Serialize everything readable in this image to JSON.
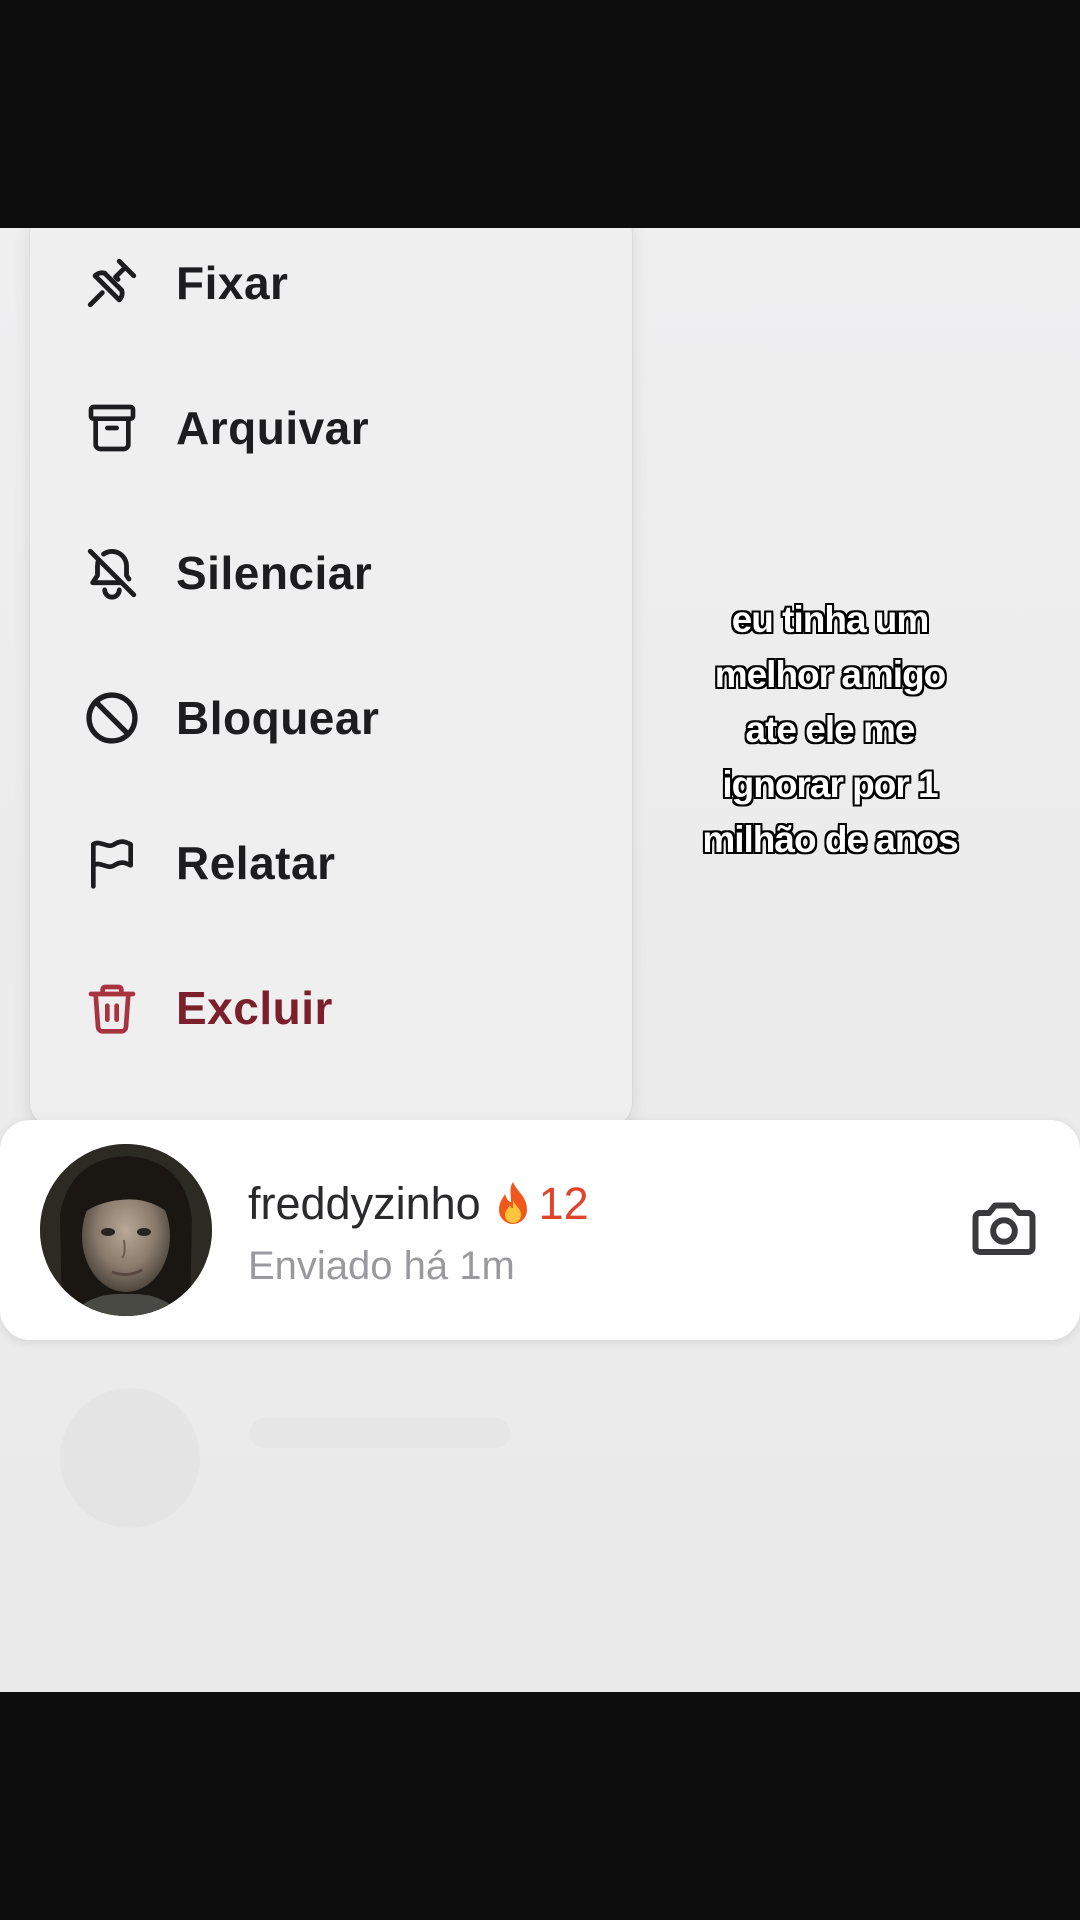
{
  "menu": {
    "items": [
      {
        "label": "Fixar",
        "icon": "pin-icon"
      },
      {
        "label": "Arquivar",
        "icon": "archive-icon"
      },
      {
        "label": "Silenciar",
        "icon": "bell-off-icon"
      },
      {
        "label": "Bloquear",
        "icon": "block-icon"
      },
      {
        "label": "Relatar",
        "icon": "flag-icon"
      },
      {
        "label": "Excluir",
        "icon": "trash-icon",
        "danger": true
      }
    ]
  },
  "caption": {
    "lines": [
      "eu tinha um",
      "melhor amigo",
      "ate ele me",
      "ignorar por 1",
      "milhão de anos"
    ]
  },
  "chat": {
    "name": "freddyzinho",
    "streak_icon": "fire-icon",
    "streak": "12",
    "status": "Enviado há 1m",
    "action_icon": "camera-icon"
  },
  "colors": {
    "danger": "#7a1f2b",
    "streak": "#e0442a",
    "text": "#1d1d1f",
    "muted": "#9a9a9e"
  }
}
